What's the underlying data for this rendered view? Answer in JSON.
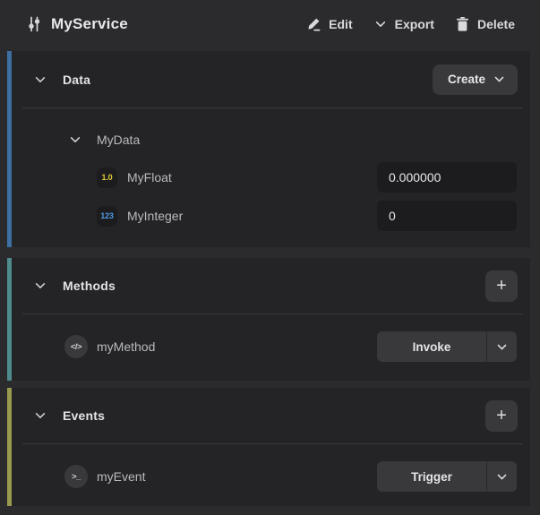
{
  "header": {
    "title": "MyService",
    "edit_label": "Edit",
    "export_label": "Export",
    "delete_label": "Delete"
  },
  "data_section": {
    "title": "Data",
    "create_label": "Create",
    "group_name": "MyData",
    "fields": [
      {
        "name": "MyFloat",
        "type_badge": "1.0",
        "value": "0.000000"
      },
      {
        "name": "MyInteger",
        "type_badge": "123",
        "value": "0"
      }
    ]
  },
  "methods_section": {
    "title": "Methods",
    "add_label": "+",
    "items": [
      {
        "name": "myMethod",
        "action_label": "Invoke"
      }
    ]
  },
  "events_section": {
    "title": "Events",
    "add_label": "+",
    "items": [
      {
        "name": "myEvent",
        "action_label": "Trigger"
      }
    ]
  },
  "colors": {
    "page_bg": "#2b2b2d",
    "panel_bg": "#242426",
    "control_bg": "#39393b",
    "input_bg": "#1c1c1e",
    "data_accent": "#3d6fa3",
    "methods_accent": "#4e8b8e",
    "events_accent": "#99994f",
    "float_type_color": "#e0cb3a",
    "integer_type_color": "#4d9ce6"
  }
}
